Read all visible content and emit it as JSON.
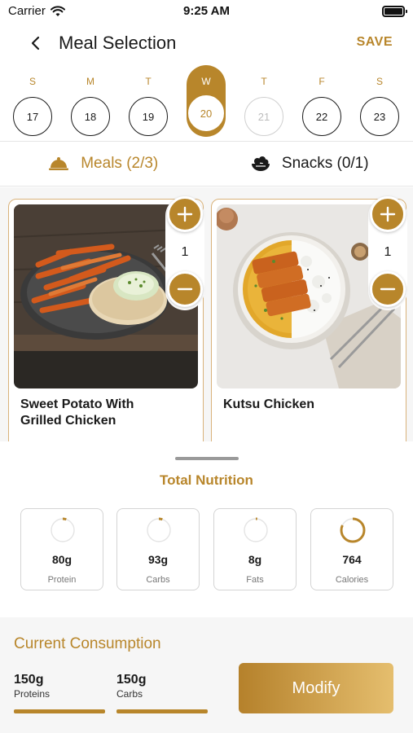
{
  "status": {
    "carrier": "Carrier",
    "time": "9:25 AM"
  },
  "nav": {
    "title": "Meal Selection",
    "save_label": "SAVE"
  },
  "days": [
    {
      "letter": "S",
      "date": "17"
    },
    {
      "letter": "M",
      "date": "18"
    },
    {
      "letter": "T",
      "date": "19"
    },
    {
      "letter": "W",
      "date": "20"
    },
    {
      "letter": "T",
      "date": "21"
    },
    {
      "letter": "F",
      "date": "22"
    },
    {
      "letter": "S",
      "date": "23"
    }
  ],
  "tabs": {
    "meals": "Meals (2/3)",
    "snacks": "Snacks (0/1)"
  },
  "meals": [
    {
      "name": "Sweet Potato With Grilled Chicken",
      "quantity": "1"
    },
    {
      "name": "Kutsu Chicken",
      "quantity": "1"
    }
  ],
  "nutrition": {
    "title": "Total Nutrition",
    "items": [
      {
        "value": "80g",
        "label": "Protein",
        "progress": 0.05
      },
      {
        "value": "93g",
        "label": "Carbs",
        "progress": 0.05
      },
      {
        "value": "8g",
        "label": "Fats",
        "progress": 0.02
      },
      {
        "value": "764",
        "label": "Calories",
        "progress": 0.82
      }
    ]
  },
  "consumption": {
    "title": "Current Consumption",
    "items": [
      {
        "value": "150g",
        "label": "Proteins"
      },
      {
        "value": "150g",
        "label": "Carbs"
      }
    ],
    "modify_label": "Modify"
  },
  "colors": {
    "accent": "#b8862b",
    "disabled": "#bdbdbd",
    "panel": "#f6f6f6"
  }
}
